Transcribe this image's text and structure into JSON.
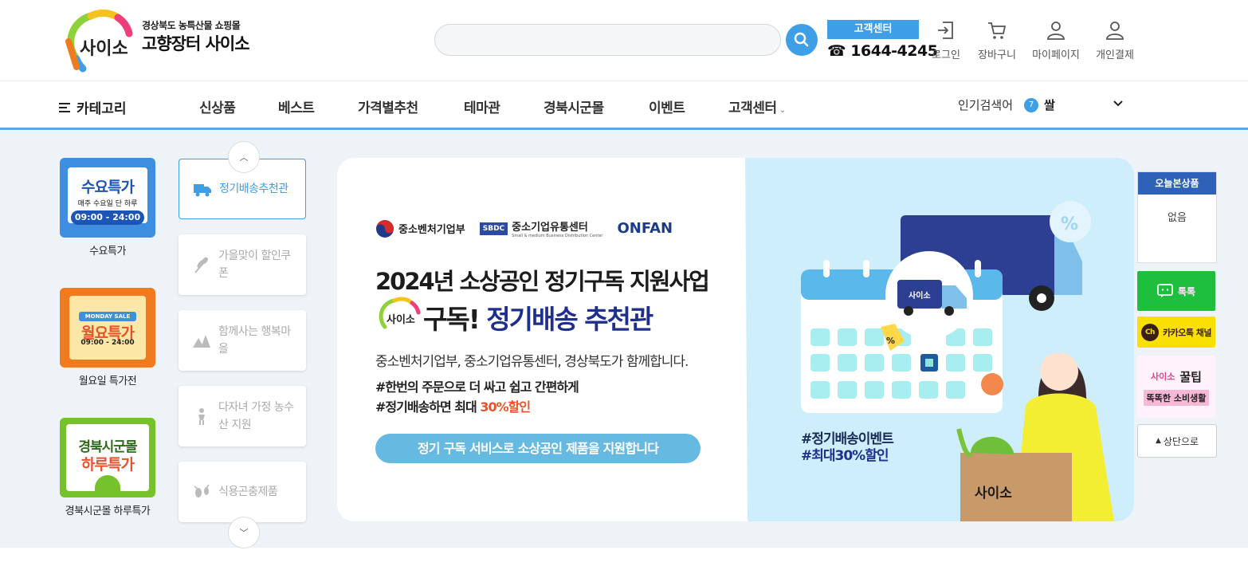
{
  "header": {
    "logo_sub": "경상북도 농특산물 쇼핑몰",
    "logo_main": "고향장터 사이소",
    "logo_mark": "사이소",
    "search": {
      "placeholder": "",
      "value": ""
    },
    "customer_center": {
      "label": "고객센터",
      "phone": "☎ 1644-4245"
    },
    "icons": [
      {
        "name": "login-icon",
        "label": "로그인"
      },
      {
        "name": "cart-icon",
        "label": "장바구니"
      },
      {
        "name": "mypage-icon",
        "label": "마이페이지"
      },
      {
        "name": "personal-pay-icon",
        "label": "개인결제"
      }
    ]
  },
  "nav": {
    "category": "카테고리",
    "items": [
      "신상품",
      "베스트",
      "가격별추천",
      "테마관",
      "경북시군몰",
      "이벤트",
      "고객센터"
    ],
    "popular": {
      "label": "인기검색어",
      "rank": "7",
      "word": "쌀"
    }
  },
  "promos": [
    {
      "label": "수요특가",
      "img_title": "수요특가",
      "img_sub": "매주 수요일 단 하루",
      "img_time": "09:00 - 24:00",
      "color": "#3e8fe0"
    },
    {
      "label": "월요일 특가전",
      "img_title": "월요특가",
      "img_sub": "MONDAY SALE",
      "img_time": "09:00 - 24:00",
      "color": "#f07a1d"
    },
    {
      "label": "경북시군몰 하루특가",
      "img_title": "경북시군몰",
      "img_sub": "하루특가",
      "img_time": "",
      "color": "#76c22a"
    }
  ],
  "themes": [
    {
      "label": "정기배송추천관",
      "icon": "truck-icon",
      "active": true
    },
    {
      "label": "가을맞이 할인쿠폰",
      "icon": "wheat-icon",
      "active": false
    },
    {
      "label": "함께사는 행복마을",
      "icon": "village-icon",
      "active": false
    },
    {
      "label": "다자녀 가정 농수산 지원",
      "icon": "child-icon",
      "active": false
    },
    {
      "label": "식용곤충제품",
      "icon": "insect-icon",
      "active": false
    }
  ],
  "banner": {
    "org1": "중소벤처기업부",
    "org2_badge": "SBDC",
    "org2": "중소기업유통센터",
    "org2_sub": "Small & medium Business Distribution Center",
    "org3": "ONFAN",
    "title1": "2024년 소상공인 정기구독 지원사업",
    "title2_pre": "구독!",
    "title2_accent": "정기배송 추천관",
    "logo_mark": "사이소",
    "desc": "중소벤처기업부, 중소기업유통센터, 경상북도가 함께합니다.",
    "tag1": "#한번의 주문으로 더 싸고 쉽고 간편하게",
    "tag2_pre": "#정기배송하면 최대 ",
    "tag2_hl": "30%할인",
    "cta": "정기 구독 서비스로 소상공인 제품을 지원합니다",
    "hash1": "#정기배송이벤트",
    "hash2": "#최대30%할인",
    "truck_label": "사이소",
    "bag_label": "사이소"
  },
  "sidebar": {
    "recent_title": "오늘본상품",
    "recent_empty": "없음",
    "talk": "톡톡",
    "kakao": "카카오톡 채널",
    "tip_title": "꿀팁",
    "tip_sub": "똑똑한 소비생활",
    "tip_logo": "사이소",
    "to_top": "상단으로"
  },
  "colors": {
    "accent": "#3e9ee6",
    "nav_border": "#5aa8e6",
    "main_bg": "#eef3f8",
    "banner_right": "#cdeefa",
    "talk": "#1fbf3e",
    "kakao": "#f9e000"
  }
}
